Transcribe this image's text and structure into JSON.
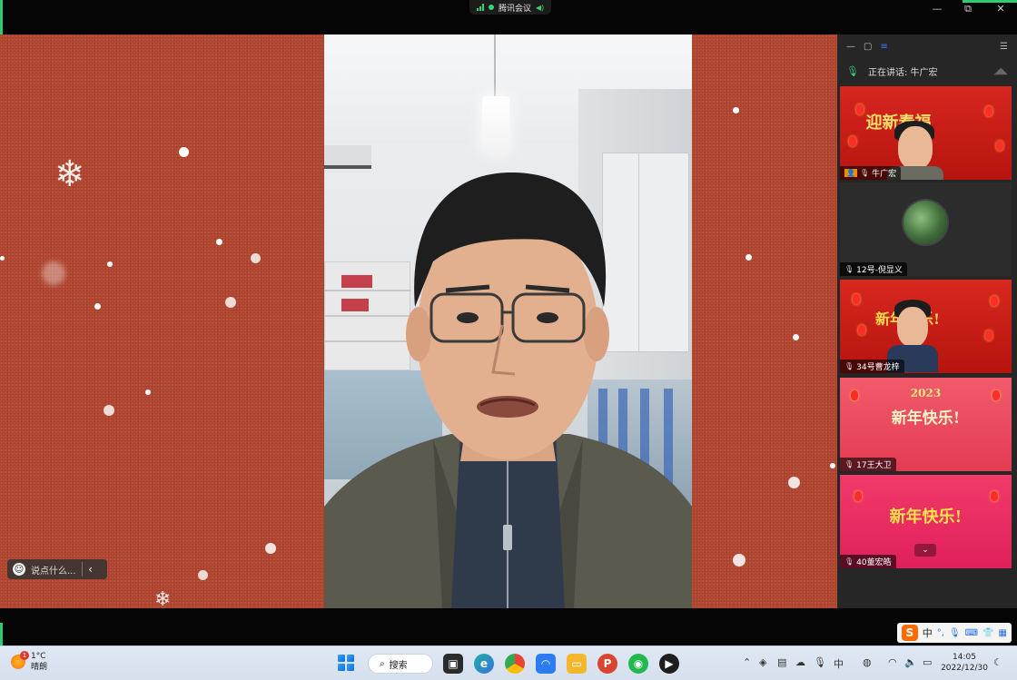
{
  "window": {
    "app_title": "腾讯会议",
    "controls": [
      "minimize",
      "restore",
      "close"
    ]
  },
  "stage": {
    "chat_placeholder": "说点什么...",
    "chat_collapse_icon": "chevron-left-icon"
  },
  "panel": {
    "speaking_label": "正在讲话:",
    "speaking_name": "牛广宏",
    "participants": [
      {
        "name": "牛广宏",
        "banner_text": "迎新春福",
        "type": "camera"
      },
      {
        "name": "12号-倪显义",
        "type": "avatar"
      },
      {
        "name": "34号曹龙梓",
        "banner_text": "新年快乐!",
        "type": "camera"
      },
      {
        "name": "17王大卫",
        "banner_text": "新年快乐!",
        "banner_year": "2023",
        "type": "banner"
      },
      {
        "name": "40董宏皓",
        "banner_text": "新年快乐!",
        "type": "banner"
      }
    ]
  },
  "taskbar": {
    "weather_temp": "1°C",
    "weather_desc": "晴朗",
    "weather_badge": "1",
    "search_label": "搜索",
    "time": "14:05",
    "date": "2022/12/30",
    "ime_label": "中",
    "ime_logo": "S"
  },
  "colors": {
    "stage_red": "#b84a34",
    "panel_bg": "#262626",
    "speaking_green": "#3bd16f",
    "taskbar_bg": "#dfe8f4"
  }
}
